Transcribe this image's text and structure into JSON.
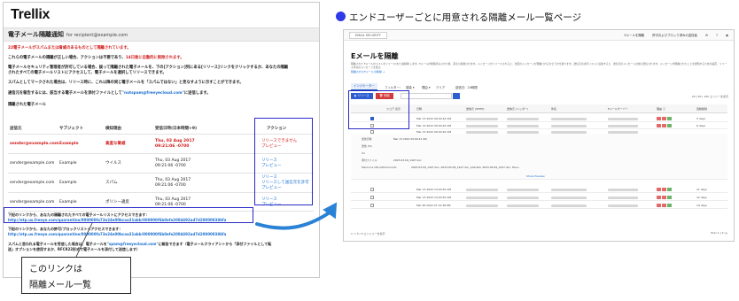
{
  "email": {
    "logo": "Trellix",
    "title": "電子メール隔離通知",
    "title_for": "for recipient@example.com",
    "alert": "22電子メールがスパムまたは脅威のあるものとして隔離されています。",
    "para1_a": "これらの電子メールの隔離が正しい場合、アクションは不要であり、",
    "para1_b": "14日後に自動的に削除されます。",
    "para2_a": "電子メールセキュリティ管理者が許可している場合、誤って隔離された電子メールを、下の[アクション]列にある[リリース]リンクをクリックするか、あなたの隔離",
    "para2_b": "されたすべての電子メールリストにアクセスして、電子メールを選択してリリースできます。",
    "para3": "スパムとしてマークされた場合は、リリース時に、これ以降の同じ電子メールを「スパムではない」と見なすように示すことができます。",
    "para4_a": "通信元を報告するには、該当する電子メールを添付ファイルとして",
    "para4_link": "\"notspam@freeyecloud.com\"",
    "para4_b": "に送信します。",
    "section": "隔離された電子メール",
    "headers": {
      "sender": "送信元",
      "subject": "サブジェクト",
      "type": "検知理由",
      "date": "受信日時(日本時間+9)",
      "action": "アクション"
    },
    "rows": [
      {
        "sender": "sender@example.com",
        "subject": "Example",
        "type": "高度な脅威",
        "date1": "Thu, 03 Aug 2017",
        "date2": "09:21:06 -0700",
        "act1": "リリースできません",
        "act2": "プレビュー"
      },
      {
        "sender": "sender@example.com",
        "subject": "Example",
        "type": "ウイルス",
        "date1": "Thu, 03 Aug 2017",
        "date2": "09:21:06 -0700",
        "act1": "リリース",
        "act2": "プレビュー"
      },
      {
        "sender": "sender@example.com",
        "subject": "Example",
        "type": "スパム",
        "date1": "Thu, 03 Aug 2017",
        "date2": "09:21:06 -0700",
        "act1": "リリース",
        "act2": "リリースして送信元を許可",
        "act3": "プレビュー"
      },
      {
        "sender": "sender@example.com",
        "subject": "Example",
        "type": "ポリシー違反",
        "date1": "Thu, 03 Aug 2017",
        "date2": "09:21:06 -0700",
        "act1": "リリース",
        "act2": "プレビュー"
      }
    ],
    "list_text": "下記のリンクから、あなたの隔離されたすべての電子メールリストにアクセスできます：",
    "list_url": "http://etp.us.freeye.com/quarantine/000000fa73e24e00bcaa31abb/000000f6b0efe2004492ad7d200000386fa",
    "proxy_text": "下記のリンクから、あなたの許可/ブロックリストへアクセスできます：",
    "proxy_url": "http://etp.us.freeye.com/quarantine/000000fa73e24e00bcaa31abb/000000f6b0efe2004492ad7d200000386fa",
    "foot_a": "スパムと思われる電子メールを受信した場合は、電子メールを",
    "foot_link": "\"spam@freeyecloud.com\"",
    "foot_b": "に報告できます（電子メールクライアントから「添付ファイルとして転",
    "foot_c": "送」オプションを使用するか、RFC822形式で電子メールを添付して送信します）"
  },
  "callout": {
    "line1": "このリンクは",
    "line2": "隔離メール一覧"
  },
  "caption": "エンドユーザーごとに用意される隔離メール一覧ページ",
  "app": {
    "tab": "EMAIL SECURITY",
    "top_links": [
      "Eメールを隔離",
      "許可およびブロック済みの送信者",
      "⚙",
      "?",
      "◉"
    ],
    "title": "Eメールを隔離",
    "desc": "隔離された Eメールのリストをリリース(または削除)します。Eメールが削除済みされた後、完全に削除されます。メッセージがリリースされると、次回のメッセージが隔離されるかどうかを選べます。送信元の許可リストに追加すると、送信元のメッセージは常に配信されます。メッセージが隔離されたことを通知するための設定、リリース済みのメッセージを選ぶ",
    "desc_link": "隔離されたEメールの削除 →",
    "filters": [
      "インジケーター",
      "フィルター：",
      "感染 ▾",
      "理由 ▾",
      "クリア",
      "送信日：24時間"
    ],
    "btn_release": "▶ リリース",
    "btn_delete": "🗑 削除",
    "pager_top": "20 | 50 | 100 エンリーを表示",
    "headers": [
      "スコア 表示",
      "日時",
      "送信元 (SMTP)",
      "送信元 (ヘッダー)",
      "件名",
      "Eメールサーバー",
      "理由 ⓘ",
      "自動削除"
    ],
    "rows": [
      {
        "date": "Mar 13 2022 09:04:43 AM",
        "expiry": "5 days",
        "checked": true
      },
      {
        "date": "Mar 13 2022 09:04:43 AM",
        "expiry": "6 days",
        "checked": false
      },
      {
        "date": "Mar 13 2022 09:04:43 AM",
        "expiry": "",
        "checked": false
      }
    ],
    "detail": [
      {
        "label": "受信日時",
        "value": "Mar 13 2022 09:04:43 AM"
      },
      {
        "label": "送信 (To)",
        "value": ""
      },
      {
        "label": "CC",
        "value": ""
      },
      {
        "label": "添付ファイル",
        "value": "2023-03-09_1427.doc"
      },
      {
        "label": "Malicious URL/Attachments",
        "value": "2023-03-09_1427.doc, 2023-03-09_1427.doc_infected, 2023-03-09_1427.doc, Heur..."
      }
    ],
    "show_preview": "Show Preview",
    "rows2": [
      {
        "date": "Mar 13 2022 13:04:43 AM",
        "expiry": "11 days"
      },
      {
        "date": "Mar 13 2022 13:04:43 AM",
        "expiry": "12 days"
      },
      {
        "date": "Feb 28 2022 07:12:36 PM",
        "expiry": "14 days"
      }
    ],
    "footer_left": "1 ～ 5 / 5 エントリーを表示",
    "footer_right": "Prev 1 | 2 | ▸"
  },
  "colors": {
    "accent_blue": "#2929c8",
    "caption_dot": "#2e39e8",
    "alert_red": "#d11d1d",
    "link_blue": "#1b6fd0"
  }
}
